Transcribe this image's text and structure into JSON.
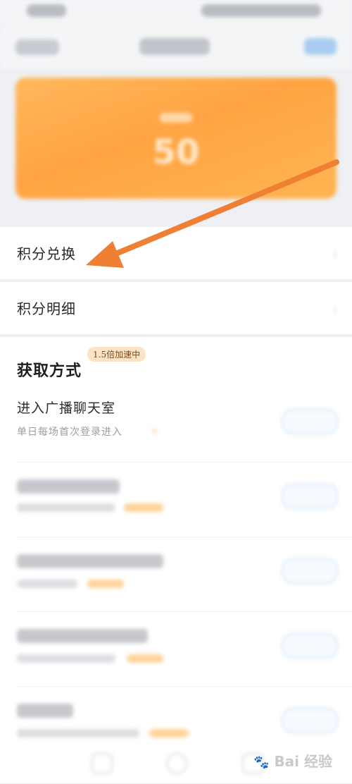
{
  "card": {
    "points": "50"
  },
  "menu": {
    "exchange": "积分兑换",
    "detail": "积分明细"
  },
  "earn": {
    "title": "获取方式",
    "badge": "1.5倍加速中",
    "tasks": [
      {
        "title": "进入广播聊天室",
        "desc": "单日每场首次登录进入"
      }
    ]
  },
  "watermark": {
    "text": "Bai 经验"
  },
  "colors": {
    "card": "#ffa443",
    "arrow": "#ee7f33",
    "badge_bg": "#fbe3c6",
    "button_border": "#cfe3f6"
  }
}
